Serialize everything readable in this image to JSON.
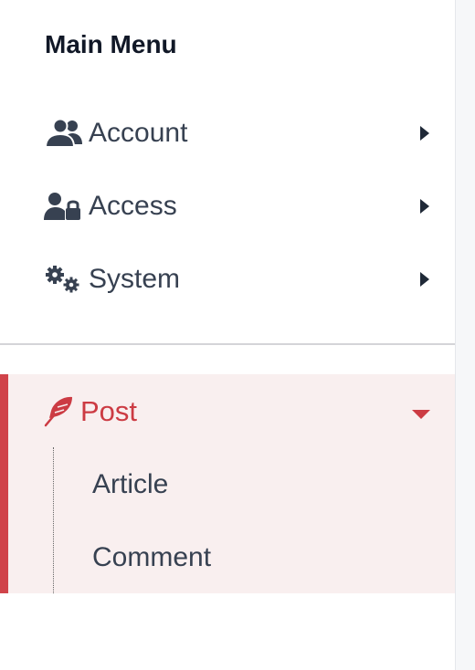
{
  "menu": {
    "heading": "Main Menu",
    "items": [
      {
        "label": "Account",
        "icon": "users-icon"
      },
      {
        "label": "Access",
        "icon": "user-lock-icon"
      },
      {
        "label": "System",
        "icon": "gears-icon"
      }
    ]
  },
  "post": {
    "label": "Post",
    "icon": "feather-icon",
    "expanded": true,
    "accent_color": "#d0434a",
    "background_color": "#f9efef",
    "children": [
      {
        "label": "Article"
      },
      {
        "label": "Comment"
      }
    ]
  }
}
